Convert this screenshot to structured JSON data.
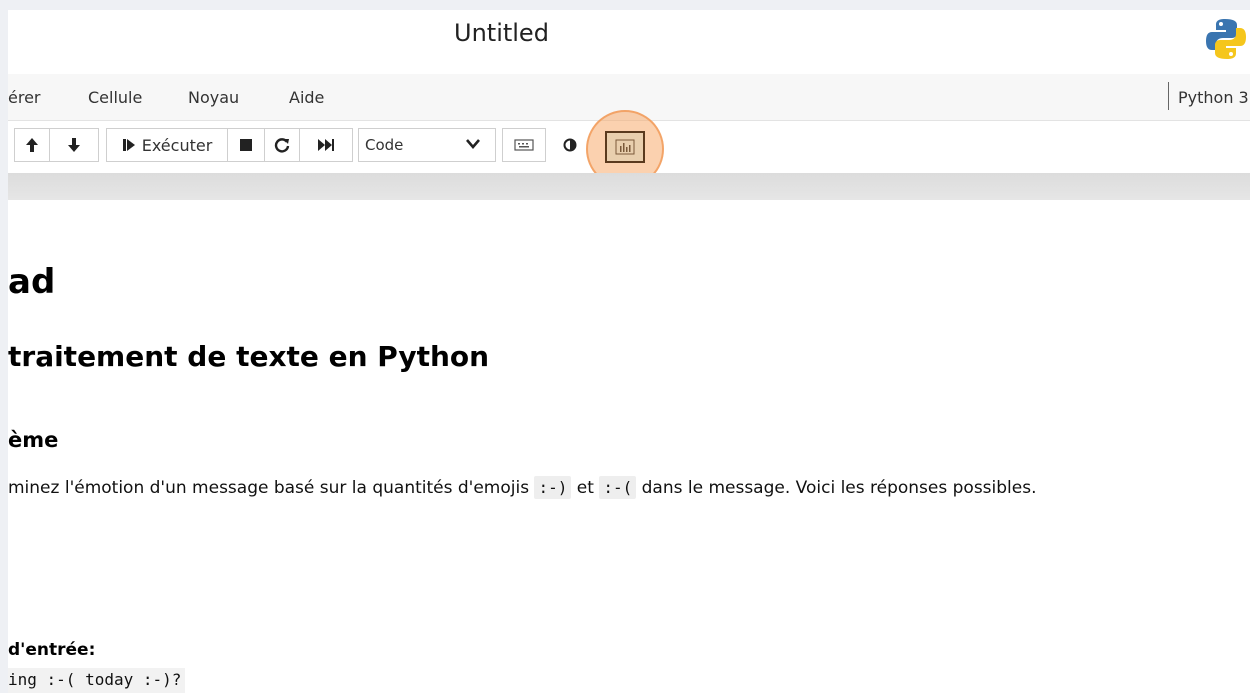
{
  "notebook": {
    "title": "Untitled",
    "logo_icon": "python-logo-icon"
  },
  "menubar": {
    "items": [
      "érer",
      "Cellule",
      "Noyau",
      "Aide"
    ],
    "kernel": "Python 3"
  },
  "toolbar": {
    "run_label": "Exécuter",
    "cell_type": "Code",
    "icons": [
      "move-up-icon",
      "move-down-icon",
      "run-icon",
      "stop-icon",
      "restart-icon",
      "fast-forward-icon",
      "chevron-down-icon",
      "keyboard-icon",
      "contrast-icon",
      "chart-icon"
    ]
  },
  "content": {
    "h1": "ad",
    "h2": "traitement de texte en Python",
    "h3": "ème",
    "para": {
      "before": "minez l'émotion d'un message basé sur la quantités d'emojis ",
      "code1": ":-)",
      "middle": " et ",
      "code2": ":-(",
      "after": " dans le message. Voici les réponses possibles."
    },
    "input_label": "d'entrée:",
    "input_code": "ing :-( today :-)?"
  },
  "colors": {
    "highlight": "#f7ab6e",
    "chart_button_border": "#8a5a2b"
  }
}
